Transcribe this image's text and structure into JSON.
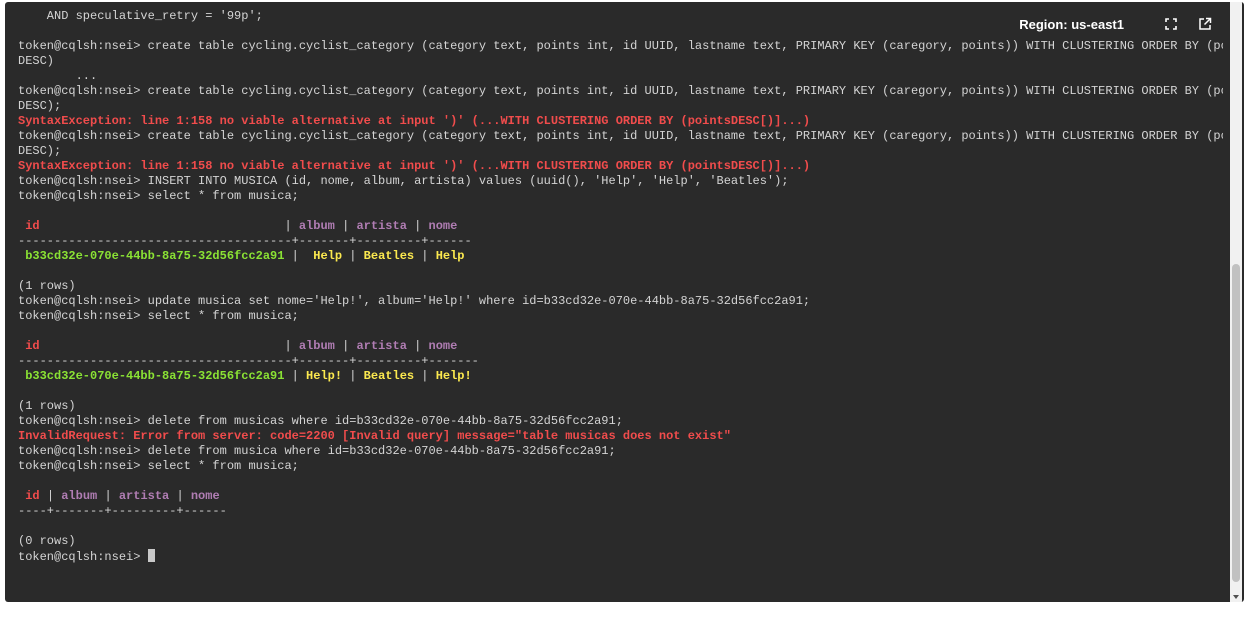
{
  "header": {
    "region_label": "Region: us-east1",
    "fullscreen_icon": "fullscreen-icon",
    "open_external_icon": "open-external-icon"
  },
  "terminal": {
    "lines": [
      {
        "kind": "plain",
        "text": "    AND speculative_retry = '99p';"
      },
      {
        "kind": "plain",
        "text": ""
      },
      {
        "kind": "plain",
        "text": "token@cqlsh:nsei> create table cycling.cyclist_category (category text, points int, id UUID, lastname text, PRIMARY KEY (caregory, points)) WITH CLUSTERING ORDER BY (points"
      },
      {
        "kind": "plain",
        "text": "DESC)"
      },
      {
        "kind": "plain",
        "text": "        ..."
      },
      {
        "kind": "plain",
        "text": "token@cqlsh:nsei> create table cycling.cyclist_category (category text, points int, id UUID, lastname text, PRIMARY KEY (caregory, points)) WITH CLUSTERING ORDER BY (points"
      },
      {
        "kind": "plain",
        "text": "DESC);"
      },
      {
        "kind": "error",
        "text": "SyntaxException: line 1:158 no viable alternative at input ')' (...WITH CLUSTERING ORDER BY (pointsDESC[)]...)"
      },
      {
        "kind": "plain",
        "text": "token@cqlsh:nsei> create table cycling.cyclist_category (category text, points int, id UUID, lastname text, PRIMARY KEY (caregory, points)) WITH CLUSTERING ORDER BY (points"
      },
      {
        "kind": "plain",
        "text": "DESC);"
      },
      {
        "kind": "error",
        "text": "SyntaxException: line 1:158 no viable alternative at input ')' (...WITH CLUSTERING ORDER BY (pointsDESC[)]...)"
      },
      {
        "kind": "plain",
        "text": "token@cqlsh:nsei> INSERT INTO MUSICA (id, nome, album, artista) values (uuid(), 'Help', 'Help', 'Beatles');"
      },
      {
        "kind": "plain",
        "text": "token@cqlsh:nsei> select * from musica;"
      },
      {
        "kind": "plain",
        "text": ""
      },
      {
        "kind": "header",
        "cells": [
          "id",
          "album",
          "artista",
          "nome"
        ],
        "pad": [
          " id                                  ",
          " album ",
          " artista ",
          " nome"
        ]
      },
      {
        "kind": "plain",
        "text": "--------------------------------------+-------+---------+------"
      },
      {
        "kind": "row",
        "cells": [
          " b33cd32e-070e-44bb-8a75-32d56fcc2a91 ",
          "  Help ",
          " Beatles ",
          " Help"
        ]
      },
      {
        "kind": "plain",
        "text": ""
      },
      {
        "kind": "plain",
        "text": "(1 rows)"
      },
      {
        "kind": "plain",
        "text": "token@cqlsh:nsei> update musica set nome='Help!', album='Help!' where id=b33cd32e-070e-44bb-8a75-32d56fcc2a91;"
      },
      {
        "kind": "plain",
        "text": "token@cqlsh:nsei> select * from musica;"
      },
      {
        "kind": "plain",
        "text": ""
      },
      {
        "kind": "header",
        "cells": [
          "id",
          "album",
          "artista",
          "nome"
        ],
        "pad": [
          " id                                  ",
          " album ",
          " artista ",
          " nome"
        ]
      },
      {
        "kind": "plain",
        "text": "--------------------------------------+-------+---------+-------"
      },
      {
        "kind": "row",
        "cells": [
          " b33cd32e-070e-44bb-8a75-32d56fcc2a91 ",
          " Help! ",
          " Beatles ",
          " Help!"
        ]
      },
      {
        "kind": "plain",
        "text": ""
      },
      {
        "kind": "plain",
        "text": "(1 rows)"
      },
      {
        "kind": "plain",
        "text": "token@cqlsh:nsei> delete from musicas where id=b33cd32e-070e-44bb-8a75-32d56fcc2a91;"
      },
      {
        "kind": "error",
        "text": "InvalidRequest: Error from server: code=2200 [Invalid query] message=\"table musicas does not exist\""
      },
      {
        "kind": "plain",
        "text": "token@cqlsh:nsei> delete from musica where id=b33cd32e-070e-44bb-8a75-32d56fcc2a91;"
      },
      {
        "kind": "plain",
        "text": "token@cqlsh:nsei> select * from musica;"
      },
      {
        "kind": "plain",
        "text": ""
      },
      {
        "kind": "header",
        "cells": [
          "id",
          "album",
          "artista",
          "nome"
        ],
        "pad": [
          " id ",
          " album ",
          " artista ",
          " nome"
        ]
      },
      {
        "kind": "plain",
        "text": "----+-------+---------+------"
      },
      {
        "kind": "plain",
        "text": ""
      },
      {
        "kind": "plain",
        "text": "(0 rows)"
      },
      {
        "kind": "prompt",
        "text": "token@cqlsh:nsei> "
      }
    ]
  }
}
